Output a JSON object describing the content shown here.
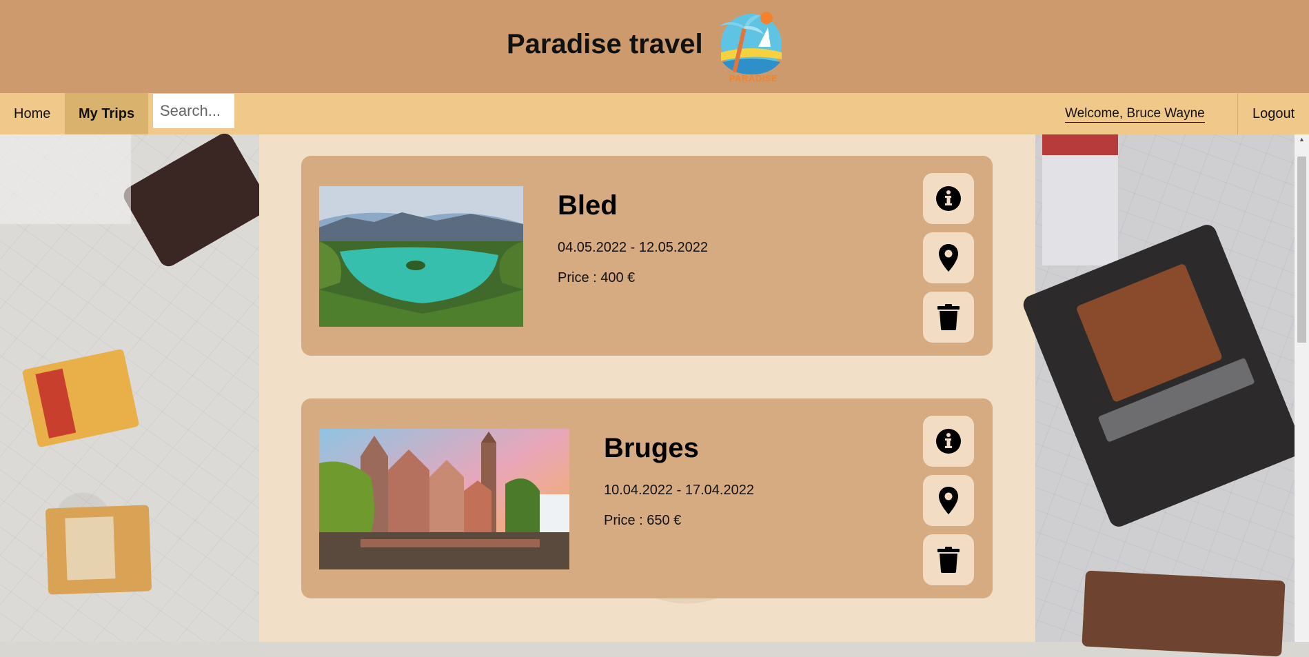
{
  "header": {
    "title": "Paradise travel",
    "logo_text": "PARADISE"
  },
  "nav": {
    "home_label": "Home",
    "mytrips_label": "My Trips",
    "search_placeholder": "Search...",
    "welcome_text": "Welcome, Bruce Wayne",
    "logout_label": "Logout"
  },
  "trips": [
    {
      "name": "Bled",
      "dates": "04.05.2022 - 12.05.2022",
      "price": "Price : 400 €",
      "image": "lake-island-photo"
    },
    {
      "name": "Bruges",
      "dates": "10.04.2022 - 17.04.2022",
      "price": "Price : 650 €",
      "image": "canal-town-photo"
    }
  ],
  "actions": [
    {
      "icon": "info-icon"
    },
    {
      "icon": "map-pin-icon"
    },
    {
      "icon": "trash-icon"
    }
  ],
  "colors": {
    "header_bg": "#cc9a6d",
    "navbar_bg": "#f0c98a",
    "active_tab_bg": "#d9b26e",
    "card_bg": "#d7ab82",
    "action_bg": "#f3dcc4"
  }
}
